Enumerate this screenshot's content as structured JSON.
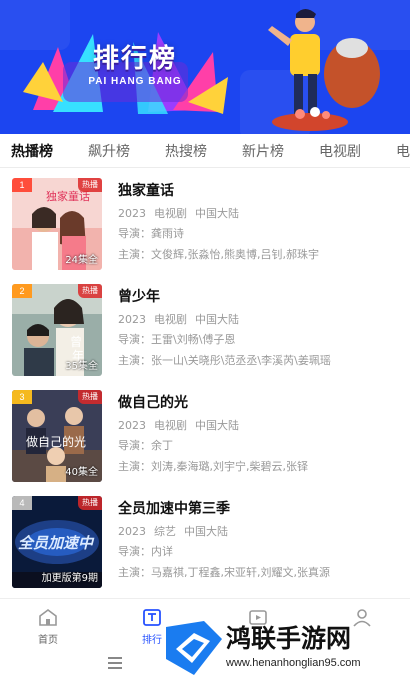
{
  "banner": {
    "title": "排行榜",
    "subtitle": "PAI HANG BANG",
    "colors": {
      "background": "#1c45f0",
      "fan_pink": "#ff3fa8",
      "fan_cyan": "#37e0ff",
      "fan_yellow": "#ffd23a",
      "fan_purple": "#9b3dff"
    }
  },
  "tabs": [
    {
      "label": "热播榜",
      "active": true
    },
    {
      "label": "飙升榜",
      "active": false
    },
    {
      "label": "热搜榜",
      "active": false
    },
    {
      "label": "新片榜",
      "active": false
    },
    {
      "label": "电视剧",
      "active": false
    },
    {
      "label": "电",
      "active": false
    }
  ],
  "list": {
    "director_label": "导演：",
    "cast_label": "主演：",
    "hot_badge": "热播",
    "items": [
      {
        "rank": "1",
        "rank_color": "#ff4d3b",
        "title": "独家童话",
        "year": "2023",
        "genre": "电视剧",
        "region": "中国大陆",
        "director": "龚雨诗",
        "cast": "文俊辉,张淼怡,熊奥博,吕钊,郝珠宇",
        "episodes": "24集全",
        "poster_colors": [
          "#f6c7c7",
          "#f3a6a6",
          "#c7e3f5"
        ]
      },
      {
        "rank": "2",
        "rank_color": "#ff9a1f",
        "title": "曾少年",
        "year": "2023",
        "genre": "电视剧",
        "region": "中国大陆",
        "director": "王雷\\刘畅\\傅子恩",
        "cast": "张一山\\关晓彤\\范丞丞\\李溪芮\\姜珮瑶",
        "episodes": "35集全",
        "poster_colors": [
          "#8ea3a0",
          "#5d6e70",
          "#d8dcd4"
        ]
      },
      {
        "rank": "3",
        "rank_color": "#f5b91e",
        "title": "做自己的光",
        "year": "2023",
        "genre": "电视剧",
        "region": "中国大陆",
        "director": "余丁",
        "cast": "刘涛,秦海璐,刘宇宁,柴碧云,张铎",
        "episodes": "40集全",
        "poster_colors": [
          "#3a3e57",
          "#b07b56",
          "#e6c79b"
        ]
      },
      {
        "rank": "4",
        "rank_color": "#b9b9b9",
        "title": "全员加速中第三季",
        "year": "2023",
        "genre": "综艺",
        "region": "中国大陆",
        "director": "内详",
        "cast": "马嘉祺,丁程鑫,宋亚轩,刘耀文,张真源",
        "episodes": "加更版第9期",
        "poster_colors": [
          "#0a1a3a",
          "#2b6ad8",
          "#bcd8ff"
        ]
      }
    ]
  },
  "bottom_nav": {
    "items": [
      {
        "label": "首页",
        "icon": "home-icon",
        "active": false
      },
      {
        "label": "排行",
        "icon": "rank-icon",
        "active": true
      },
      {
        "label": "",
        "icon": "video-icon",
        "active": false
      },
      {
        "label": "",
        "icon": "user-icon",
        "active": false
      }
    ]
  },
  "watermark": {
    "text": "鸿联手游网",
    "url": "www.henanhonglian95.com"
  }
}
